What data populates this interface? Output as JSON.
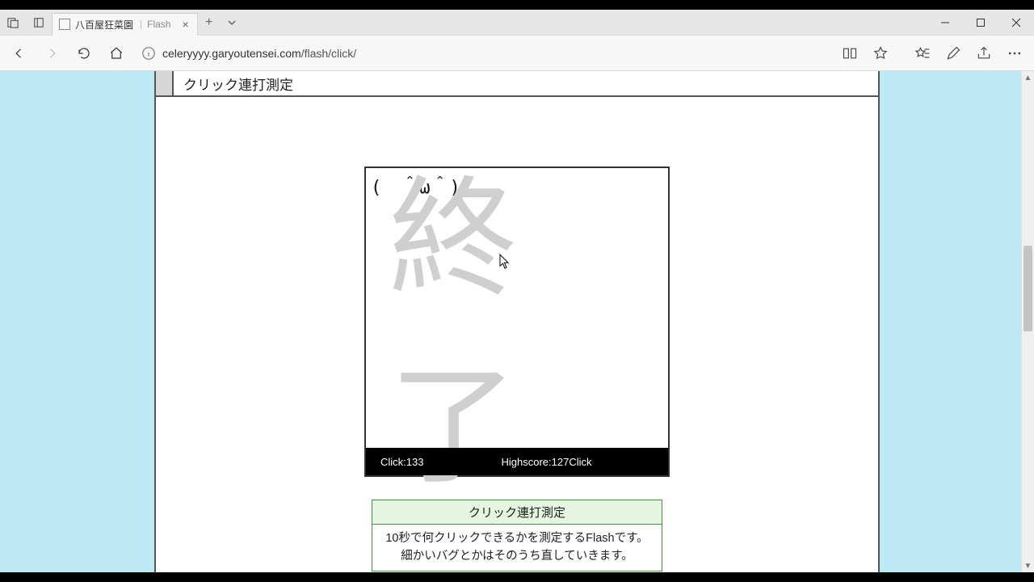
{
  "browser": {
    "tab": {
      "title_main": "八百屋狂菜園",
      "title_sub": "Flash"
    },
    "url_host": "celeryyyy.garyoutensei.com",
    "url_path": "/flash/click/"
  },
  "page": {
    "section_title": "クリック連打測定",
    "flash": {
      "face": "(　＾ω＾)",
      "big_text": "終了",
      "click_label": "Click:",
      "click_value": "133",
      "highscore_label": "Highscore:",
      "highscore_value": "127Click"
    },
    "description": {
      "title": "クリック連打測定",
      "line1": "10秒で何クリックできるかを測定するFlashです。",
      "line2": "細かいバグとかはそのうち直していきます。"
    }
  },
  "scrollbar": {
    "thumb_top_pct": 34,
    "thumb_height_pct": 18
  }
}
